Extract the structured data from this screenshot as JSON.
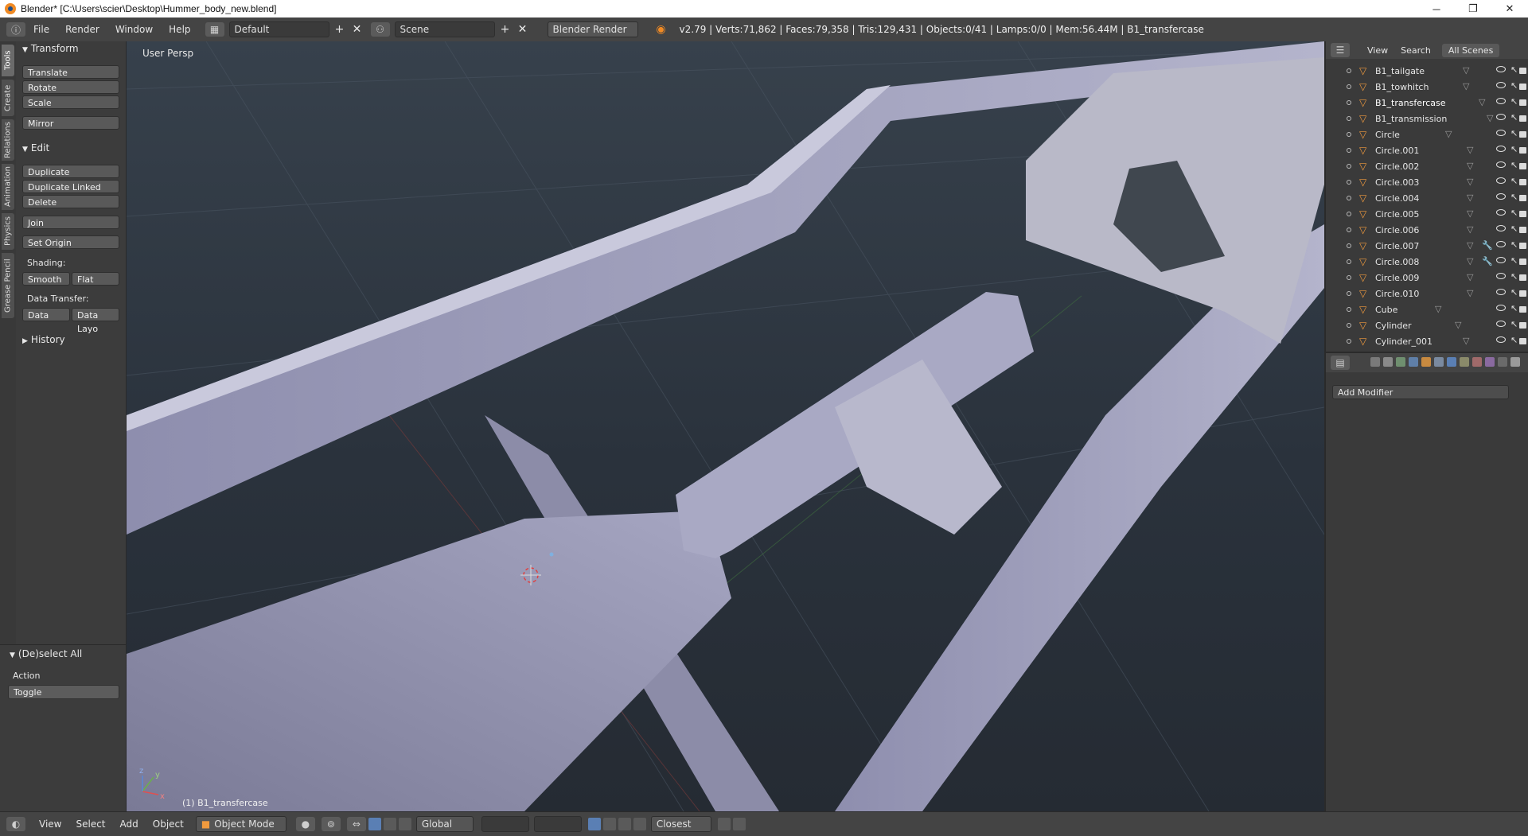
{
  "window": {
    "title": "Blender* [C:\\Users\\scier\\Desktop\\Hummer_body_new.blend]",
    "controls": {
      "minimize": "─",
      "maximize": "❐",
      "close": "✕"
    }
  },
  "info_header": {
    "menus": [
      "File",
      "Render",
      "Window",
      "Help"
    ],
    "layout": "Default",
    "scene": "Scene",
    "engine": "Blender Render",
    "stats": "v2.79 | Verts:71,862 | Faces:79,358 | Tris:129,431 | Objects:0/41 | Lamps:0/0 | Mem:56.44M | B1_transfercase"
  },
  "tool_tabs": [
    "Tools",
    "Create",
    "Relations",
    "Animation",
    "Physics",
    "Grease Pencil"
  ],
  "tool_shelf": {
    "transform": {
      "title": "Transform",
      "buttons": [
        "Translate",
        "Rotate",
        "Scale",
        "Mirror"
      ]
    },
    "edit": {
      "title": "Edit",
      "buttons": [
        "Duplicate",
        "Duplicate Linked",
        "Delete",
        "Join"
      ],
      "set_origin": "Set Origin",
      "shading_label": "Shading:",
      "shading": [
        "Smooth",
        "Flat"
      ],
      "data_transfer_label": "Data Transfer:",
      "data_transfer": [
        "Data",
        "Data Layo"
      ]
    },
    "history": "History"
  },
  "operator_panel": {
    "title": "(De)select All",
    "action_label": "Action",
    "action_value": "Toggle"
  },
  "viewport": {
    "view_label": "User Persp",
    "selected_label": "(1) B1_transfercase",
    "axis_labels": {
      "x": "x",
      "y": "y",
      "z": "z"
    }
  },
  "outliner": {
    "header": {
      "view": "View",
      "search": "Search",
      "scope": "All Scenes"
    },
    "items": [
      {
        "name": "B1_tailgate",
        "selected": false,
        "modifier": false
      },
      {
        "name": "B1_towhitch",
        "selected": false,
        "modifier": false
      },
      {
        "name": "B1_transfercase",
        "selected": true,
        "modifier": false
      },
      {
        "name": "B1_transmission",
        "selected": false,
        "modifier": false
      },
      {
        "name": "Circle",
        "selected": false,
        "modifier": false
      },
      {
        "name": "Circle.001",
        "selected": false,
        "modifier": false
      },
      {
        "name": "Circle.002",
        "selected": false,
        "modifier": false
      },
      {
        "name": "Circle.003",
        "selected": false,
        "modifier": false
      },
      {
        "name": "Circle.004",
        "selected": false,
        "modifier": false
      },
      {
        "name": "Circle.005",
        "selected": false,
        "modifier": false
      },
      {
        "name": "Circle.006",
        "selected": false,
        "modifier": false
      },
      {
        "name": "Circle.007",
        "selected": false,
        "modifier": true
      },
      {
        "name": "Circle.008",
        "selected": false,
        "modifier": true
      },
      {
        "name": "Circle.009",
        "selected": false,
        "modifier": false
      },
      {
        "name": "Circle.010",
        "selected": false,
        "modifier": false
      },
      {
        "name": "Cube",
        "selected": false,
        "modifier": false
      },
      {
        "name": "Cylinder",
        "selected": false,
        "modifier": false
      },
      {
        "name": "Cylinder_001",
        "selected": false,
        "modifier": false
      }
    ]
  },
  "properties": {
    "add_modifier": "Add Modifier"
  },
  "bottom_header": {
    "menus": [
      "View",
      "Select",
      "Add",
      "Object"
    ],
    "mode": "Object Mode",
    "orientation": "Global",
    "snap_target": "Closest"
  },
  "colors": {
    "accent_selected": "#5a7fb4",
    "object_icon": "#f09a3e",
    "mesh_surface": "#9a9ab8",
    "viewport_bg": "#2e3640"
  }
}
